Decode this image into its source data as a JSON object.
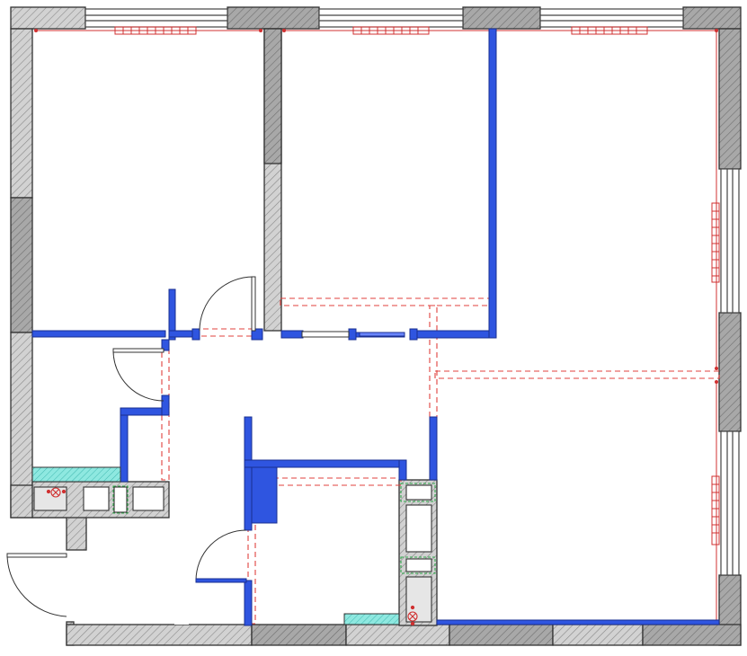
{
  "drawing": {
    "kind": "apartment floor plan",
    "colors": {
      "background": "#ffffff",
      "outer_wall_fill": "#c8c8c8",
      "outer_wall_dark": "#9a9a9a",
      "new_partition": "#2f55e0",
      "demolition_dash": "#e0403c",
      "wet_zone": "#8ee8e0",
      "shaft_fill": "#e6e6e6",
      "vent_grille": "#2fa84a",
      "window_frame": "#444444"
    },
    "icons": {
      "floor_drain": "circled-x-icon",
      "door_swing": "door-arc-icon",
      "radiator": "radiator-icon",
      "window": "window-icon"
    }
  }
}
